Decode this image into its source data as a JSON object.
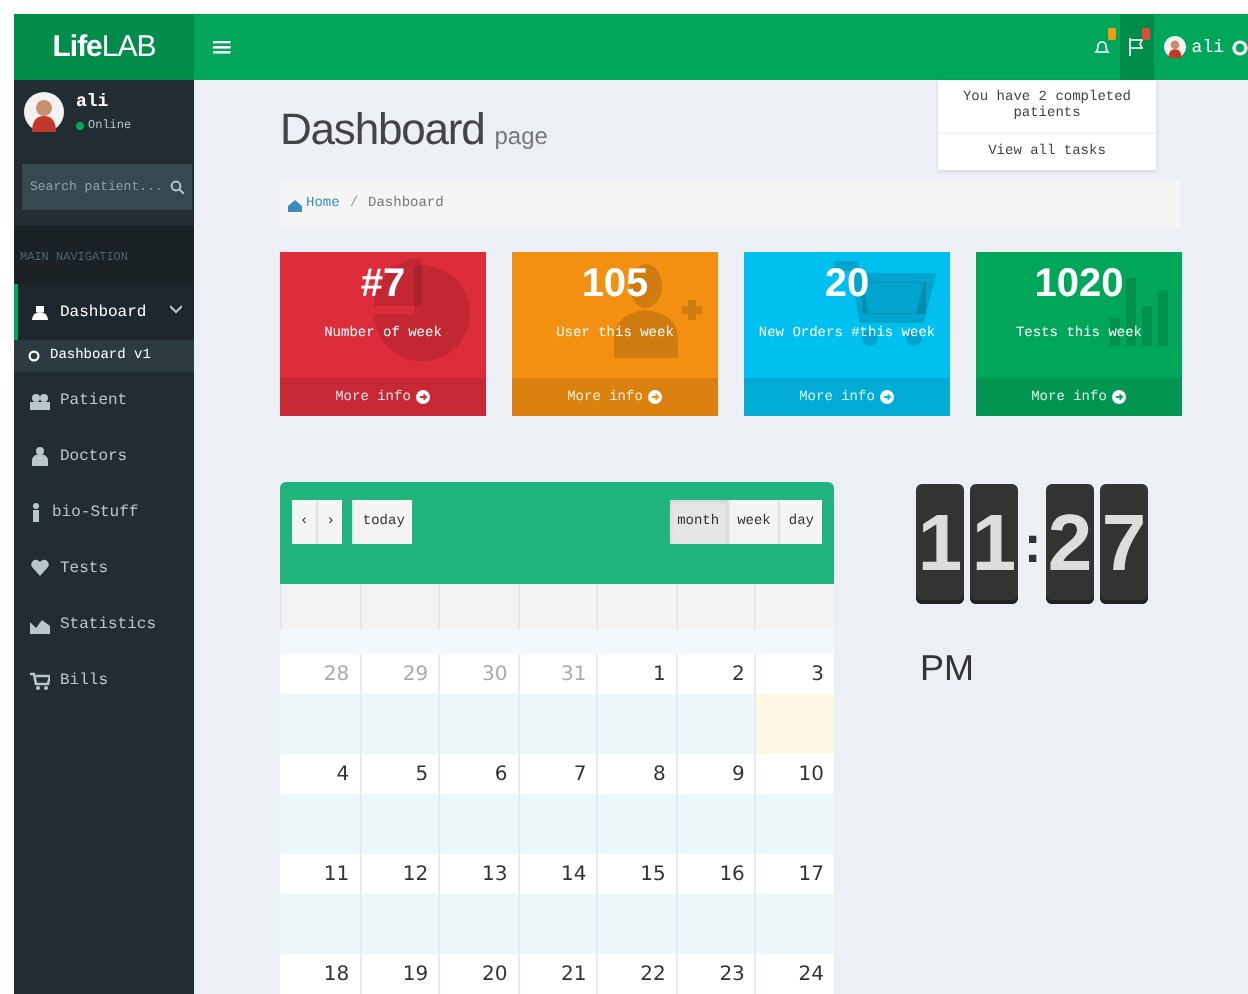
{
  "header": {
    "logo_bold": "Life",
    "logo_rest": "LAB",
    "menu_toggle": "≡",
    "user_name": "ali"
  },
  "tasks_dropdown": {
    "message": "You have 2 completed patients",
    "footer": "View all tasks"
  },
  "sidebar": {
    "user": {
      "name": "ali",
      "status": "Online"
    },
    "search": {
      "placeholder": "Search patient..."
    },
    "section": "MAIN NAVIGATION",
    "items": [
      {
        "label": "Dashboard",
        "kind": "dashboard",
        "selected": true,
        "expanded": true,
        "children": [
          {
            "label": "Dashboard v1",
            "selected": true
          }
        ]
      },
      {
        "label": "Patient",
        "kind": "patient",
        "selected": false
      },
      {
        "label": "Doctors",
        "kind": "doctor",
        "selected": false
      },
      {
        "label": "bio-Stuff",
        "kind": "person",
        "selected": false
      },
      {
        "label": "Tests",
        "kind": "heart",
        "selected": false
      },
      {
        "label": "Statistics",
        "kind": "chart",
        "selected": false
      },
      {
        "label": "Bills",
        "kind": "cart",
        "selected": false
      }
    ]
  },
  "page": {
    "title": "Dashboard",
    "subtitle": "page",
    "breadcrumb": [
      "Home",
      "Dashboard"
    ],
    "breadcrumb_separator": "/"
  },
  "stats": [
    {
      "value": "#7",
      "label": "Number of week",
      "footer": "More info",
      "color": "#dd2d3b",
      "kind": "pie"
    },
    {
      "value": "105",
      "label": "User this week",
      "footer": "More info",
      "color": "#f39012",
      "kind": "user-add"
    },
    {
      "value": "20",
      "label": "New Orders #this week",
      "footer": "More info",
      "color": "#00c0ef",
      "kind": "cart"
    },
    {
      "value": "1020",
      "label": "Tests this week",
      "footer": "More info",
      "color": "#00a65a",
      "kind": "bars"
    }
  ],
  "calendar": {
    "prev": "‹",
    "next": "›",
    "today_button": "today",
    "views": [
      {
        "label": "month",
        "selected": true
      },
      {
        "label": "week",
        "selected": false
      },
      {
        "label": "day",
        "selected": false
      }
    ],
    "weeks": [
      [
        {
          "day": "28",
          "other_month": true,
          "today": false
        },
        {
          "day": "29",
          "other_month": true,
          "today": false
        },
        {
          "day": "30",
          "other_month": true,
          "today": false
        },
        {
          "day": "31",
          "other_month": true,
          "today": false
        },
        {
          "day": "1",
          "other_month": false,
          "today": false
        },
        {
          "day": "2",
          "other_month": false,
          "today": false
        },
        {
          "day": "3",
          "other_month": false,
          "today": true
        }
      ],
      [
        {
          "day": "4",
          "other_month": false,
          "today": false
        },
        {
          "day": "5",
          "other_month": false,
          "today": false
        },
        {
          "day": "6",
          "other_month": false,
          "today": false
        },
        {
          "day": "7",
          "other_month": false,
          "today": false
        },
        {
          "day": "8",
          "other_month": false,
          "today": false
        },
        {
          "day": "9",
          "other_month": false,
          "today": false
        },
        {
          "day": "10",
          "other_month": false,
          "today": false
        }
      ],
      [
        {
          "day": "11",
          "other_month": false,
          "today": false
        },
        {
          "day": "12",
          "other_month": false,
          "today": false
        },
        {
          "day": "13",
          "other_month": false,
          "today": false
        },
        {
          "day": "14",
          "other_month": false,
          "today": false
        },
        {
          "day": "15",
          "other_month": false,
          "today": false
        },
        {
          "day": "16",
          "other_month": false,
          "today": false
        },
        {
          "day": "17",
          "other_month": false,
          "today": false
        }
      ],
      [
        {
          "day": "18",
          "other_month": false
        },
        {
          "day": "19",
          "other_month": false
        },
        {
          "day": "20",
          "other_month": false
        },
        {
          "day": "21",
          "other_month": false
        },
        {
          "day": "22",
          "other_month": false
        },
        {
          "day": "23",
          "other_month": false
        },
        {
          "day": "24",
          "other_month": false
        }
      ]
    ]
  },
  "clock": {
    "hours": [
      "1",
      "1"
    ],
    "separator": ":",
    "minutes": [
      "2",
      "7"
    ],
    "meridiem": "PM"
  }
}
